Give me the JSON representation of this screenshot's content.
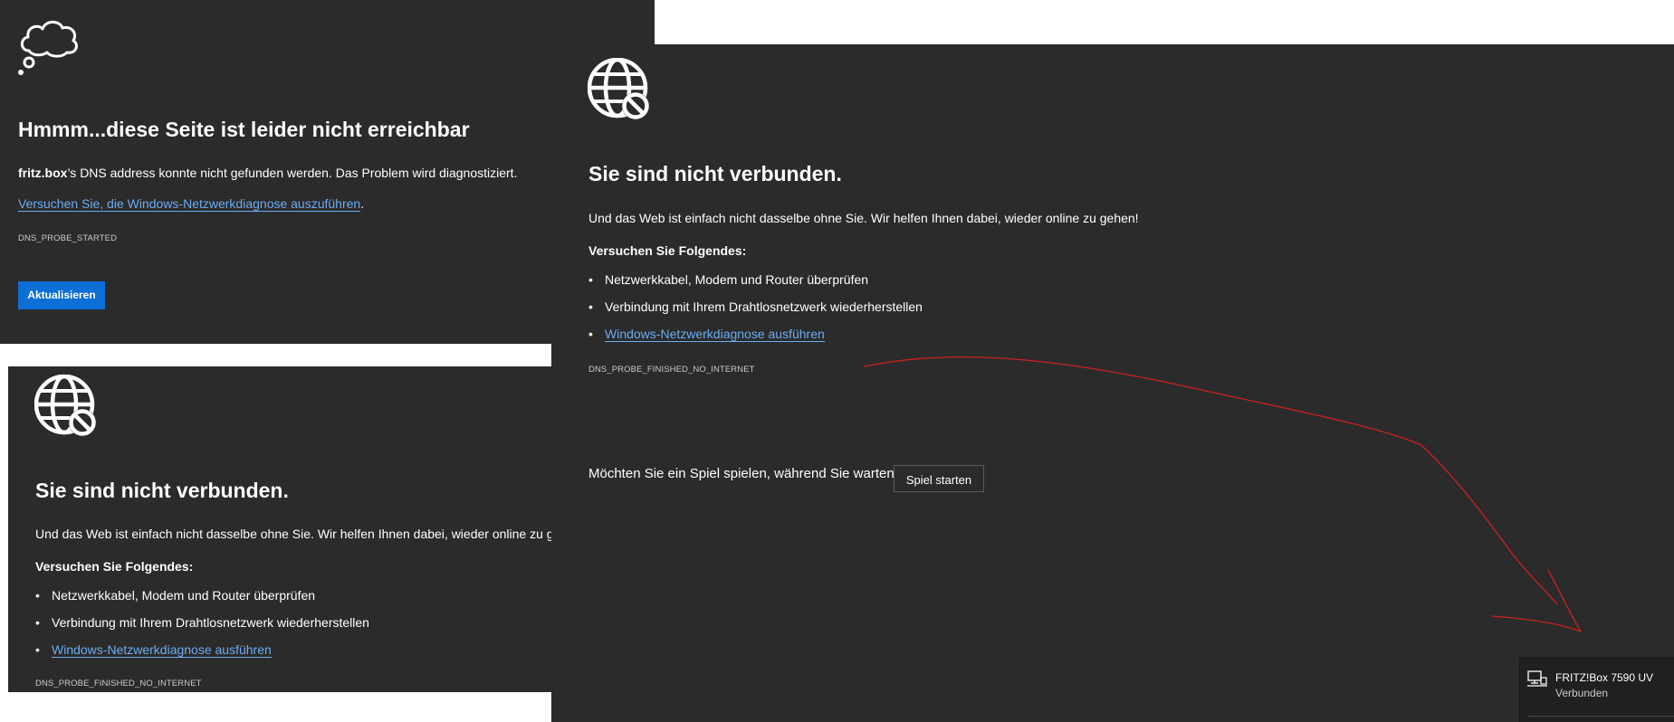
{
  "panel_top_left": {
    "icon": "thought-bubble-icon",
    "title": "Hmmm...diese Seite ist leider nicht erreichbar",
    "dns_host": "fritz.box",
    "dns_message": "’s DNS address konnte nicht gefunden werden. Das Problem wird diagnostiziert.",
    "diagnose_link": "Versuchen Sie, die Windows-Netzwerkdiagnose auszuführen",
    "diagnose_period": ".",
    "error_code": "DNS_PROBE_STARTED",
    "refresh_button": "Aktualisieren"
  },
  "panel_bottom_left": {
    "icon": "globe-blocked-icon",
    "title": "Sie sind nicht verbunden.",
    "message": "Und das Web ist einfach nicht dasselbe ohne Sie. Wir helfen Ihnen dabei, wieder online zu gehen!",
    "try_heading": "Versuchen Sie Folgendes:",
    "items": [
      "Netzwerkkabel, Modem und Router überprüfen",
      "Verbindung mit Ihrem Drahtlosnetzwerk wiederherstellen"
    ],
    "diagnose_link": "Windows-Netzwerkdiagnose ausführen",
    "error_code": "DNS_PROBE_FINISHED_NO_INTERNET"
  },
  "panel_right": {
    "icon": "globe-blocked-icon",
    "title": "Sie sind nicht verbunden.",
    "message": "Und das Web ist einfach nicht dasselbe ohne Sie. Wir helfen Ihnen dabei, wieder online zu gehen!",
    "try_heading": "Versuchen Sie Folgendes:",
    "items": [
      "Netzwerkkabel, Modem und Router überprüfen",
      "Verbindung mit Ihrem Drahtlosnetzwerk wiederherstellen"
    ],
    "diagnose_link": "Windows-Netzwerkdiagnose ausführen",
    "error_code": "DNS_PROBE_FINISHED_NO_INTERNET",
    "game_prompt": "Möchten Sie ein Spiel spielen, während Sie warten?",
    "game_button": "Spiel starten"
  },
  "network_flyout": {
    "icon": "wired-network-icon",
    "network_name": "FRITZ!Box 7590 UV",
    "status": "Verbunden"
  },
  "annotation": {
    "color": "#cc1f1f",
    "shape": "hand-drawn-arrow"
  },
  "colors": {
    "page_background": "#2b2b2b",
    "link": "#6aacf2",
    "primary_button": "#0b6fd6"
  }
}
